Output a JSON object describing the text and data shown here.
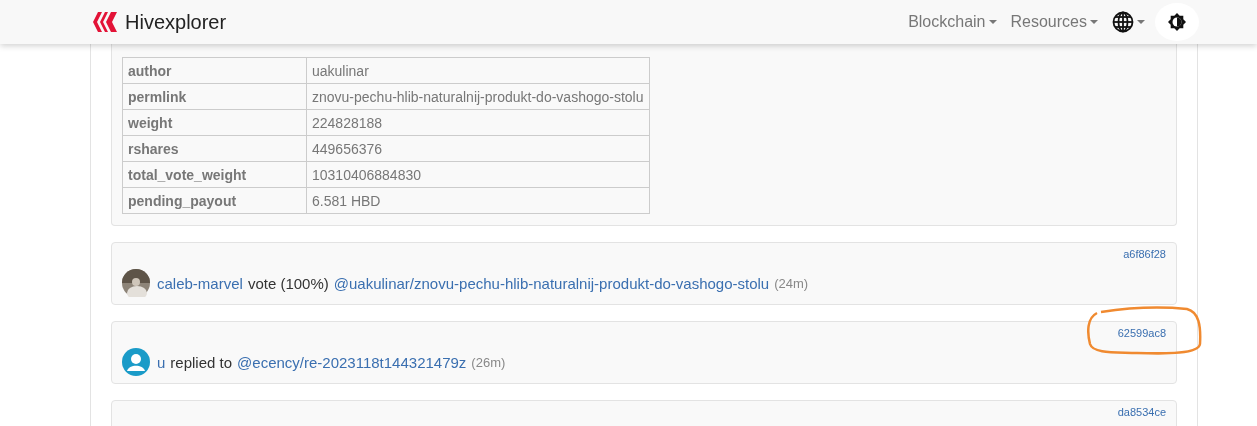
{
  "navbar": {
    "brand": "Hivexplorer",
    "menus": [
      {
        "kind": "text",
        "label": "Blockchain"
      },
      {
        "kind": "text",
        "label": "Resources"
      },
      {
        "kind": "globe"
      }
    ]
  },
  "operation_details": [
    {
      "key": "author",
      "value": "uakulinar"
    },
    {
      "key": "permlink",
      "value": "znovu-pechu-hlib-naturalnij-produkt-do-vashogo-stolu"
    },
    {
      "key": "weight",
      "value": "224828188"
    },
    {
      "key": "rshares",
      "value": "449656376"
    },
    {
      "key": "total_vote_weight",
      "value": "10310406884830"
    },
    {
      "key": "pending_payout",
      "value": "6.581 HBD"
    }
  ],
  "feed": [
    {
      "hash": "a6f86f28",
      "avatar": {
        "kind": "photo"
      },
      "actor": "caleb-marvel",
      "action": "vote (100%)",
      "target": "@uakulinar/znovu-pechu-hlib-naturalnij-produkt-do-vashogo-stolu",
      "age": "(24m)"
    },
    {
      "hash": "62599ac8",
      "avatar": {
        "kind": "default"
      },
      "actor": "u",
      "action": "replied to",
      "target": "@ecency/re-2023118t144321479z",
      "age": "(26m)"
    },
    {
      "hash": "da8534ce"
    }
  ]
}
